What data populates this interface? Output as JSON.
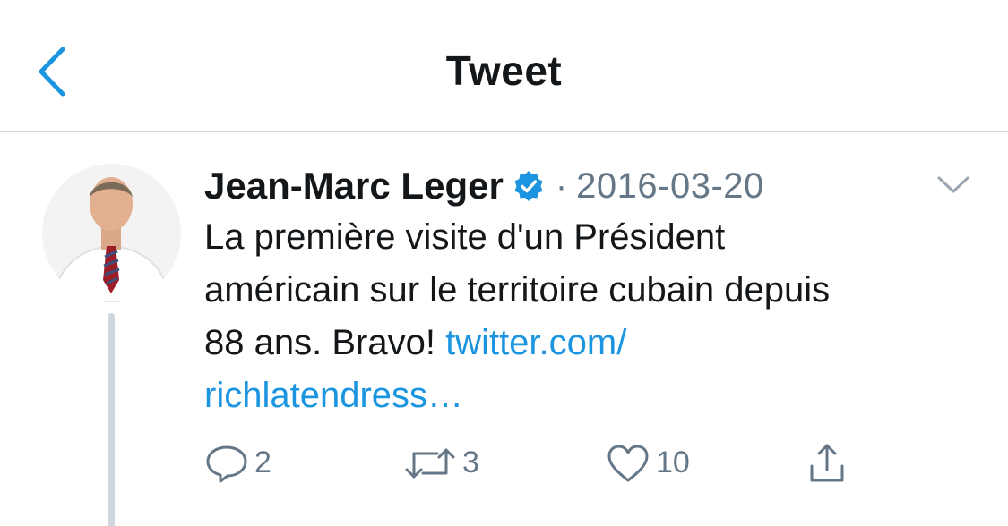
{
  "header": {
    "title": "Tweet",
    "back_icon": "chevron-left-icon"
  },
  "tweet": {
    "author_name": "Jean-Marc Leger",
    "verified": true,
    "separator": "·",
    "date": "2016-03-20",
    "text_line1": "La première visite d'un Président",
    "text_line2": "américain sur le territoire cubain depuis",
    "text_line3": "88 ans. Bravo!",
    "link_part1": "twitter.com/",
    "link_part2": "richlatendress…",
    "menu_icon": "chevron-down-icon"
  },
  "actions": {
    "reply_count": "2",
    "retweet_count": "3",
    "like_count": "10",
    "share_icon": "share-icon"
  },
  "colors": {
    "accent": "#1b95e0",
    "secondary_text": "#657786",
    "primary_text": "#14171a",
    "divider": "#cfd4d9"
  }
}
